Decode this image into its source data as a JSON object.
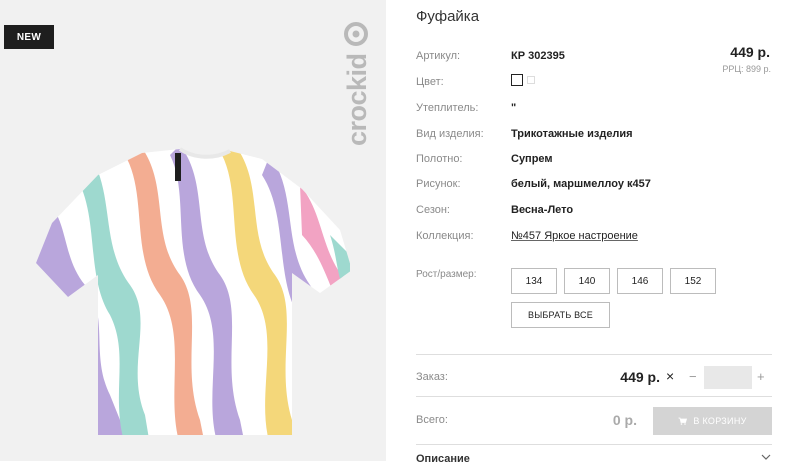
{
  "image": {
    "badge": "NEW",
    "brand_logo": "crockid"
  },
  "product": {
    "title": "Фуфайка",
    "price": "449 р.",
    "rrp": "РРЦ: 899 р.",
    "specs": [
      {
        "label": "Артикул:",
        "value": "КР 302395"
      },
      {
        "label": "Цвет:",
        "value": ""
      },
      {
        "label": "Утеплитель:",
        "value": "\""
      },
      {
        "label": "Вид изделия:",
        "value": "Трикотажные изделия"
      },
      {
        "label": "Полотно:",
        "value": "Супрем"
      },
      {
        "label": "Рисунок:",
        "value": "белый, маршмеллоу к457"
      },
      {
        "label": "Сезон:",
        "value": "Весна-Лето"
      },
      {
        "label": "Коллекция:",
        "value": "№457 Яркое настроение"
      }
    ],
    "size_label": "Рост/размер:",
    "sizes": [
      "134",
      "140",
      "146",
      "152"
    ],
    "select_all": "ВЫБРАТЬ ВСЕ"
  },
  "order": {
    "label": "Заказ:",
    "price": "449 р.",
    "times": "×",
    "minus": "−",
    "plus": "+",
    "quantity": ""
  },
  "total": {
    "label": "Всего:",
    "price": "0 р.",
    "cart_button": "В КОРЗИНУ"
  },
  "description": {
    "label": "Описание"
  },
  "colors": {
    "badge_bg": "#1e1e1e",
    "cart_disabled": "#d4d4d4",
    "image_bg": "#f1f1f1"
  }
}
